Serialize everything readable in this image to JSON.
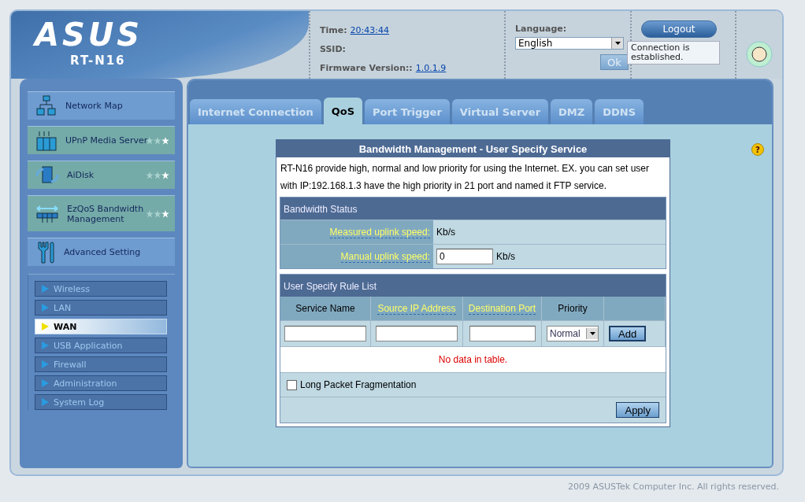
{
  "header": {
    "logo": "ASUS",
    "model": "RT-N16",
    "time_label": "Time:",
    "time": "20:43:44",
    "ssid_label": "SSID:",
    "firmware_label": "Firmware Version::",
    "firmware": "1.0.1.9",
    "language_label": "Language:",
    "language": "English",
    "ok_button": "Ok",
    "logout_button": "Logout",
    "tooltip": "Connection is established."
  },
  "sidebar": {
    "main_items": [
      {
        "label": "Network Map",
        "kind": "plain"
      },
      {
        "label": "UPnP Media Server",
        "kind": "starred"
      },
      {
        "label": "AiDisk",
        "kind": "starred"
      },
      {
        "label": "EzQoS Bandwidth Management",
        "kind": "starred"
      },
      {
        "label": "Advanced Setting",
        "kind": "plain"
      }
    ],
    "sub_items": [
      {
        "label": "Wireless",
        "selected": false
      },
      {
        "label": "LAN",
        "selected": false
      },
      {
        "label": "WAN",
        "selected": true
      },
      {
        "label": "USB Application",
        "selected": false
      },
      {
        "label": "Firewall",
        "selected": false
      },
      {
        "label": "Administration",
        "selected": false
      },
      {
        "label": "System Log",
        "selected": false
      }
    ]
  },
  "tabs": [
    {
      "label": "Internet Connection",
      "selected": false
    },
    {
      "label": "QoS",
      "selected": true
    },
    {
      "label": "Port Trigger",
      "selected": false
    },
    {
      "label": "Virtual Server",
      "selected": false
    },
    {
      "label": "DMZ",
      "selected": false
    },
    {
      "label": "DDNS",
      "selected": false
    }
  ],
  "panel": {
    "title": "Bandwidth Management - User Specify Service",
    "description": "RT-N16 provide high, normal and low priority for using the Internet. EX. you can set user with IP:192.168.1.3 have the high priority in 21 port and named it FTP service.",
    "status_title": "Bandwidth Status",
    "measured_label": "Measured uplink speed:",
    "measured_value": "Kb/s",
    "manual_label": "Manual uplink speed:",
    "manual_value": "0",
    "manual_unit": "Kb/s",
    "rule_title": "User Specify Rule List",
    "columns": [
      {
        "label": "Service Name",
        "kind": "plain"
      },
      {
        "label": "Source IP Address",
        "kind": "hint"
      },
      {
        "label": "Destination Port",
        "kind": "hint"
      },
      {
        "label": "Priority",
        "kind": "plain"
      }
    ],
    "priority": "Normal",
    "add_button": "Add",
    "empty_message": "No data in table.",
    "fragmentation": {
      "label": "Long Packet Fragmentation",
      "checked": false
    },
    "apply_button": "Apply"
  },
  "help": "?",
  "footer": "2009 ASUSTek Computer Inc. All rights reserved."
}
